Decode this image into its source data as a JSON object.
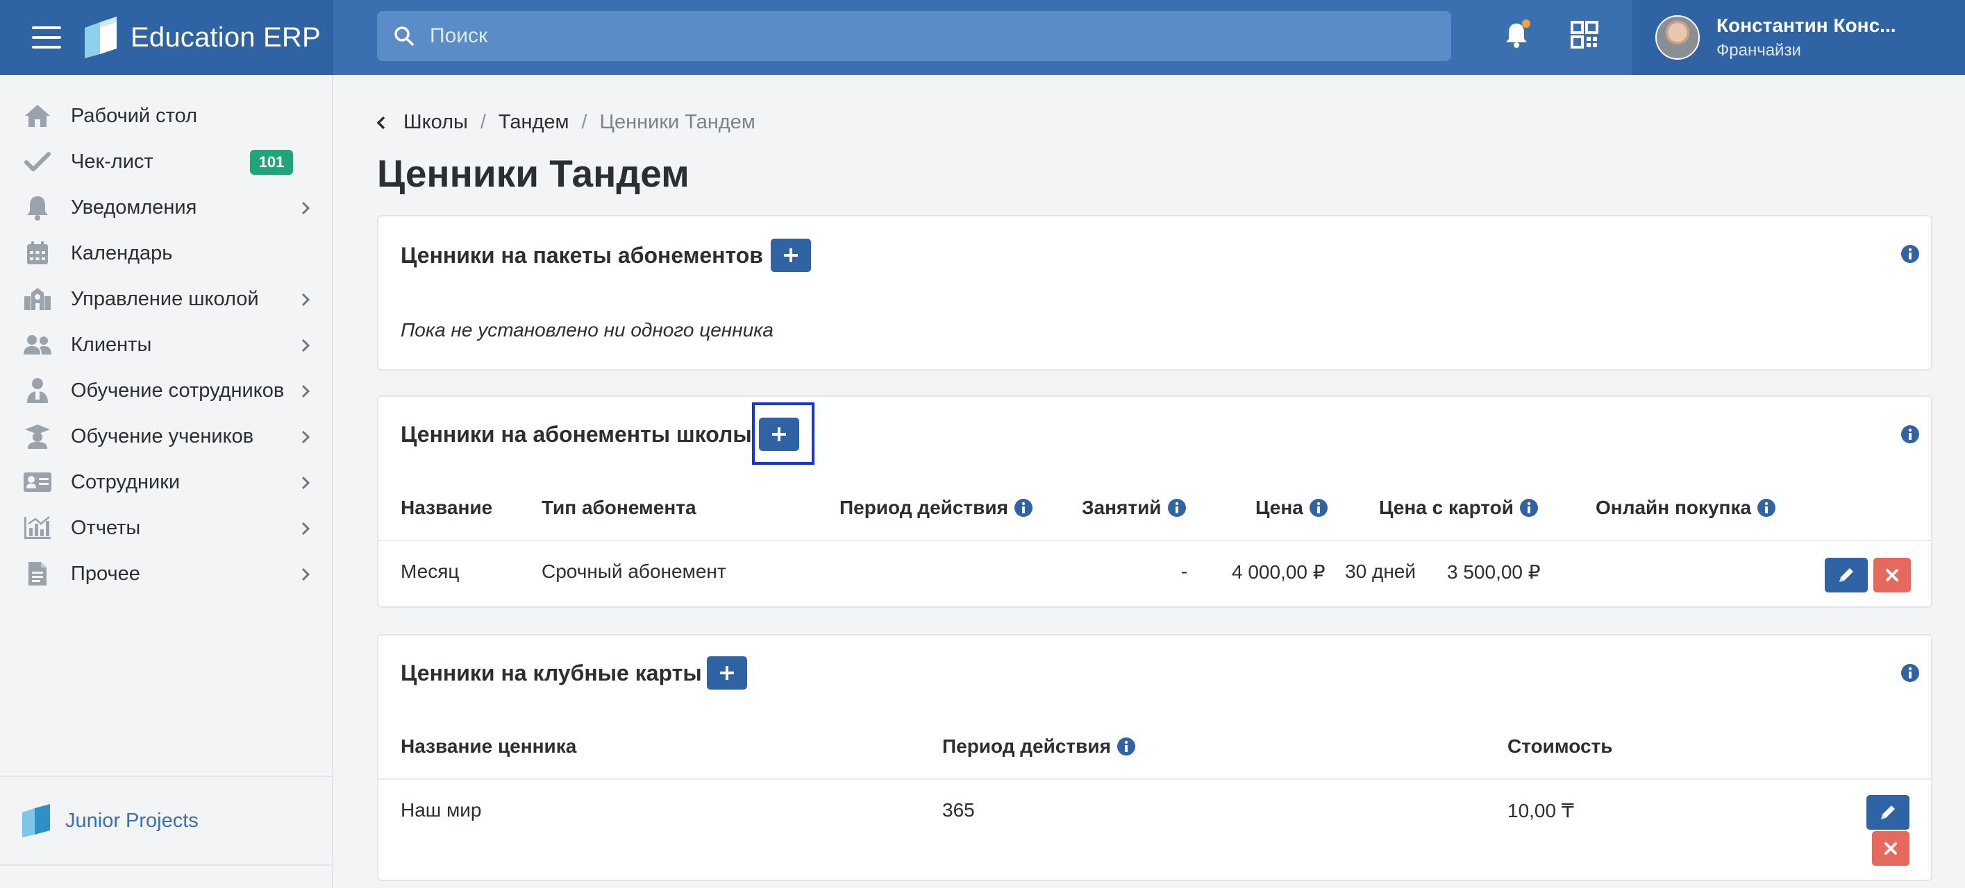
{
  "app": {
    "name": "Education ERP"
  },
  "search": {
    "placeholder": "Поиск"
  },
  "user": {
    "name": "Константин Конс...",
    "role": "Франчайзи"
  },
  "sidebar": {
    "items": [
      {
        "label": "Рабочий стол",
        "icon": "home-icon"
      },
      {
        "label": "Чек-лист",
        "icon": "check-icon",
        "badge": "101"
      },
      {
        "label": "Уведомления",
        "icon": "bell-icon"
      },
      {
        "label": "Календарь",
        "icon": "calendar-icon"
      },
      {
        "label": "Управление школой",
        "icon": "school-icon"
      },
      {
        "label": "Клиенты",
        "icon": "users-icon"
      },
      {
        "label": "Обучение сотрудников",
        "icon": "staff-training-icon"
      },
      {
        "label": "Обучение учеников",
        "icon": "graduation-cap-icon"
      },
      {
        "label": "Сотрудники",
        "icon": "id-card-icon"
      },
      {
        "label": "Отчеты",
        "icon": "chart-icon"
      },
      {
        "label": "Прочее",
        "icon": "document-icon"
      }
    ],
    "footer": {
      "label": "Junior Projects"
    }
  },
  "breadcrumb": {
    "items": [
      "Школы",
      "Тандем"
    ],
    "current": "Ценники Тандем"
  },
  "page": {
    "title": "Ценники Тандем"
  },
  "packages_card": {
    "title": "Ценники на пакеты абонементов",
    "empty": "Пока не установлено ни одного ценника"
  },
  "school_card": {
    "title": "Ценники на абонементы школы",
    "columns": [
      "Название",
      "Тип абонемента",
      "Период действия",
      "Занятий",
      "Цена",
      "Цена с картой",
      "Онлайн покупка"
    ],
    "rows": [
      {
        "name": "Месяц",
        "type": "Срочный абонемент",
        "period": "30 дней",
        "lessons": "-",
        "price": "4 000,00 ₽",
        "card_price": "3 500,00 ₽",
        "online": ""
      }
    ]
  },
  "club_card": {
    "title": "Ценники на клубные карты",
    "columns": [
      "Название ценника",
      "Период действия",
      "Стоимость"
    ],
    "rows": [
      {
        "name": "Наш мир",
        "period": "365",
        "cost": "10,00 ₸"
      }
    ]
  },
  "colors": {
    "topbar": "#3a6fb0",
    "primary": "#2f63a3",
    "danger": "#e56a5d",
    "badge": "#20a47a",
    "highlight": "#1a35d6"
  }
}
